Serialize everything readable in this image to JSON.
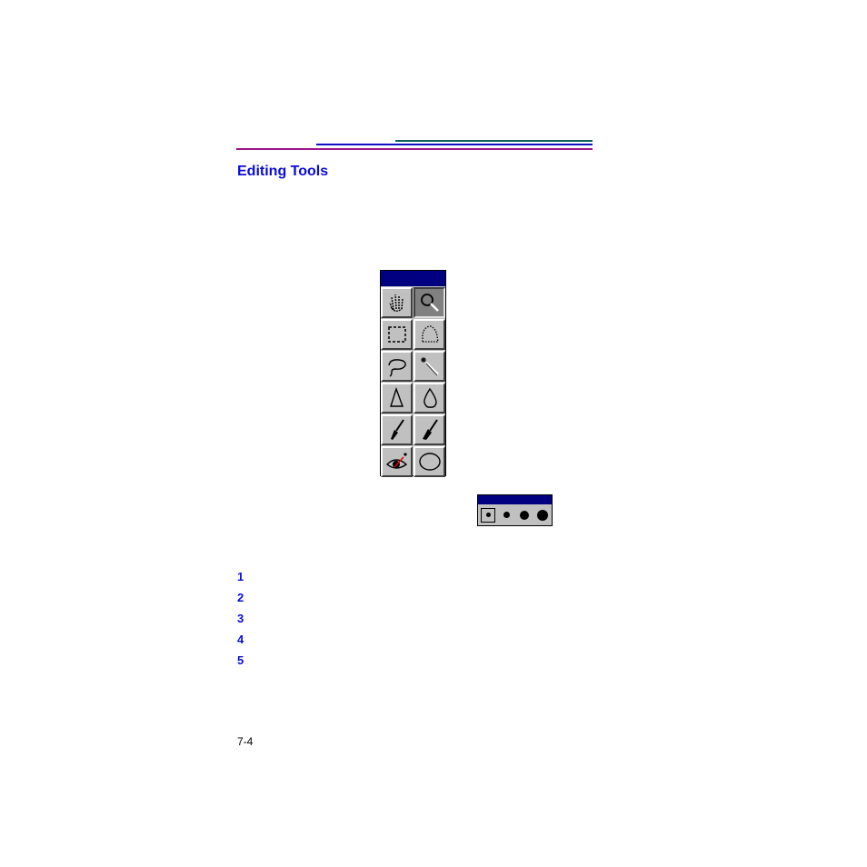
{
  "document": {
    "section_title": "Editing Tools",
    "page_number": "7-4",
    "rule_colors": [
      "#0b5e5a",
      "#1010c8",
      "#a0148c"
    ]
  },
  "toolbox": {
    "title": "",
    "title_bar_color": "#000080",
    "tools": [
      {
        "name": "hand-tool",
        "icon": "hand-icon",
        "active": false
      },
      {
        "name": "zoom-tool",
        "icon": "magnifier-icon",
        "active": true
      },
      {
        "name": "rectangle-select-tool",
        "icon": "rectangle-marquee-icon",
        "active": false
      },
      {
        "name": "freeform-select-tool",
        "icon": "freeform-marquee-icon",
        "active": false
      },
      {
        "name": "lasso-tool",
        "icon": "lasso-icon",
        "active": false
      },
      {
        "name": "magic-wand-tool",
        "icon": "magic-wand-icon",
        "active": false
      },
      {
        "name": "sharpen-tool",
        "icon": "sharpen-triangle-icon",
        "active": false
      },
      {
        "name": "blur-tool",
        "icon": "water-drop-icon",
        "active": false
      },
      {
        "name": "brush-tool",
        "icon": "brush-icon",
        "active": false
      },
      {
        "name": "smudge-brush-tool",
        "icon": "brush-alt-icon",
        "active": false
      },
      {
        "name": "red-eye-tool",
        "icon": "red-eye-icon",
        "active": false
      },
      {
        "name": "ellipse-tool",
        "icon": "ellipse-icon",
        "active": false
      }
    ]
  },
  "brush_sizes": {
    "title": "",
    "options": [
      "small",
      "medium",
      "large",
      "x-large"
    ],
    "selected": "small"
  },
  "steps": [
    "1",
    "2",
    "3",
    "4",
    "5"
  ]
}
